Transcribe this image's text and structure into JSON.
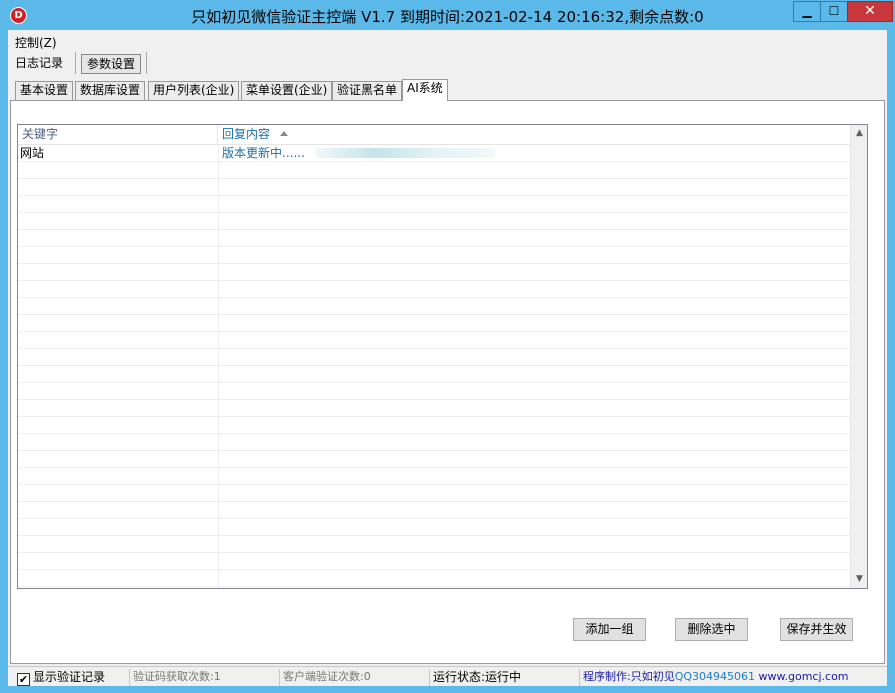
{
  "window": {
    "title": "只如初见微信验证主控端 V1.7 到期时间:2021-02-14 20:16:32,剩余点数:0",
    "icon_letter": "D",
    "controls": {
      "minimize": "▁",
      "maximize": "☐",
      "close": "✕"
    }
  },
  "menu": {
    "control": "控制(Z)"
  },
  "nav": {
    "log": "日志记录",
    "params": "参数设置"
  },
  "tabs": [
    {
      "label": "基本设置"
    },
    {
      "label": "数据库设置"
    },
    {
      "label": "用户列表(企业)"
    },
    {
      "label": "菜单设置(企业)"
    },
    {
      "label": "验证黑名单"
    },
    {
      "label": "AI系统"
    }
  ],
  "list": {
    "columns": [
      "关键字",
      "回复内容"
    ],
    "rows": [
      {
        "keyword": "网站",
        "reply": "版本更新中......"
      }
    ]
  },
  "buttons": {
    "add": "添加一组",
    "delete": "删除选中",
    "save": "保存并生效"
  },
  "status": {
    "show_log_label": "显示验证记录",
    "show_log_checked": true,
    "code_count": "验证码获取次数:1",
    "client_count": "客户端验证次数:0",
    "run_state": "运行状态:运行中",
    "credit_prefix": "程序制作:只如初见",
    "credit_qq": "QQ304945061",
    "credit_site": " www.gomcj.com"
  },
  "icons": {
    "app": "app-logo-icon",
    "sort": "sort-ascending-icon",
    "scroll_up": "scroll-up-icon",
    "scroll_down": "scroll-down-icon",
    "checkbox": "checkmark-icon"
  },
  "colors": {
    "titlebar": "#5bb9ea",
    "close": "#c7373b",
    "link": "#1e6fa8"
  }
}
